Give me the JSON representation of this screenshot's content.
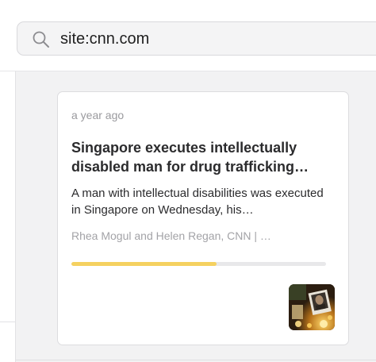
{
  "search": {
    "value": "site:cnn.com"
  },
  "article": {
    "time": "a year ago",
    "title": "Singapore executes intellectually disabled man for drug trafficking…",
    "summary": "A man with intellectual disabilities was executed in Singapore on Wednesday, his…",
    "byline": "Rhea Mogul and Helen Regan, CNN | …",
    "progress_fraction": 0.57,
    "thumbnail_icon": "news-photo"
  },
  "colors": {
    "progress_fill": "#f5d160",
    "progress_track": "#e8e8ea",
    "background": "#f2f2f3"
  }
}
